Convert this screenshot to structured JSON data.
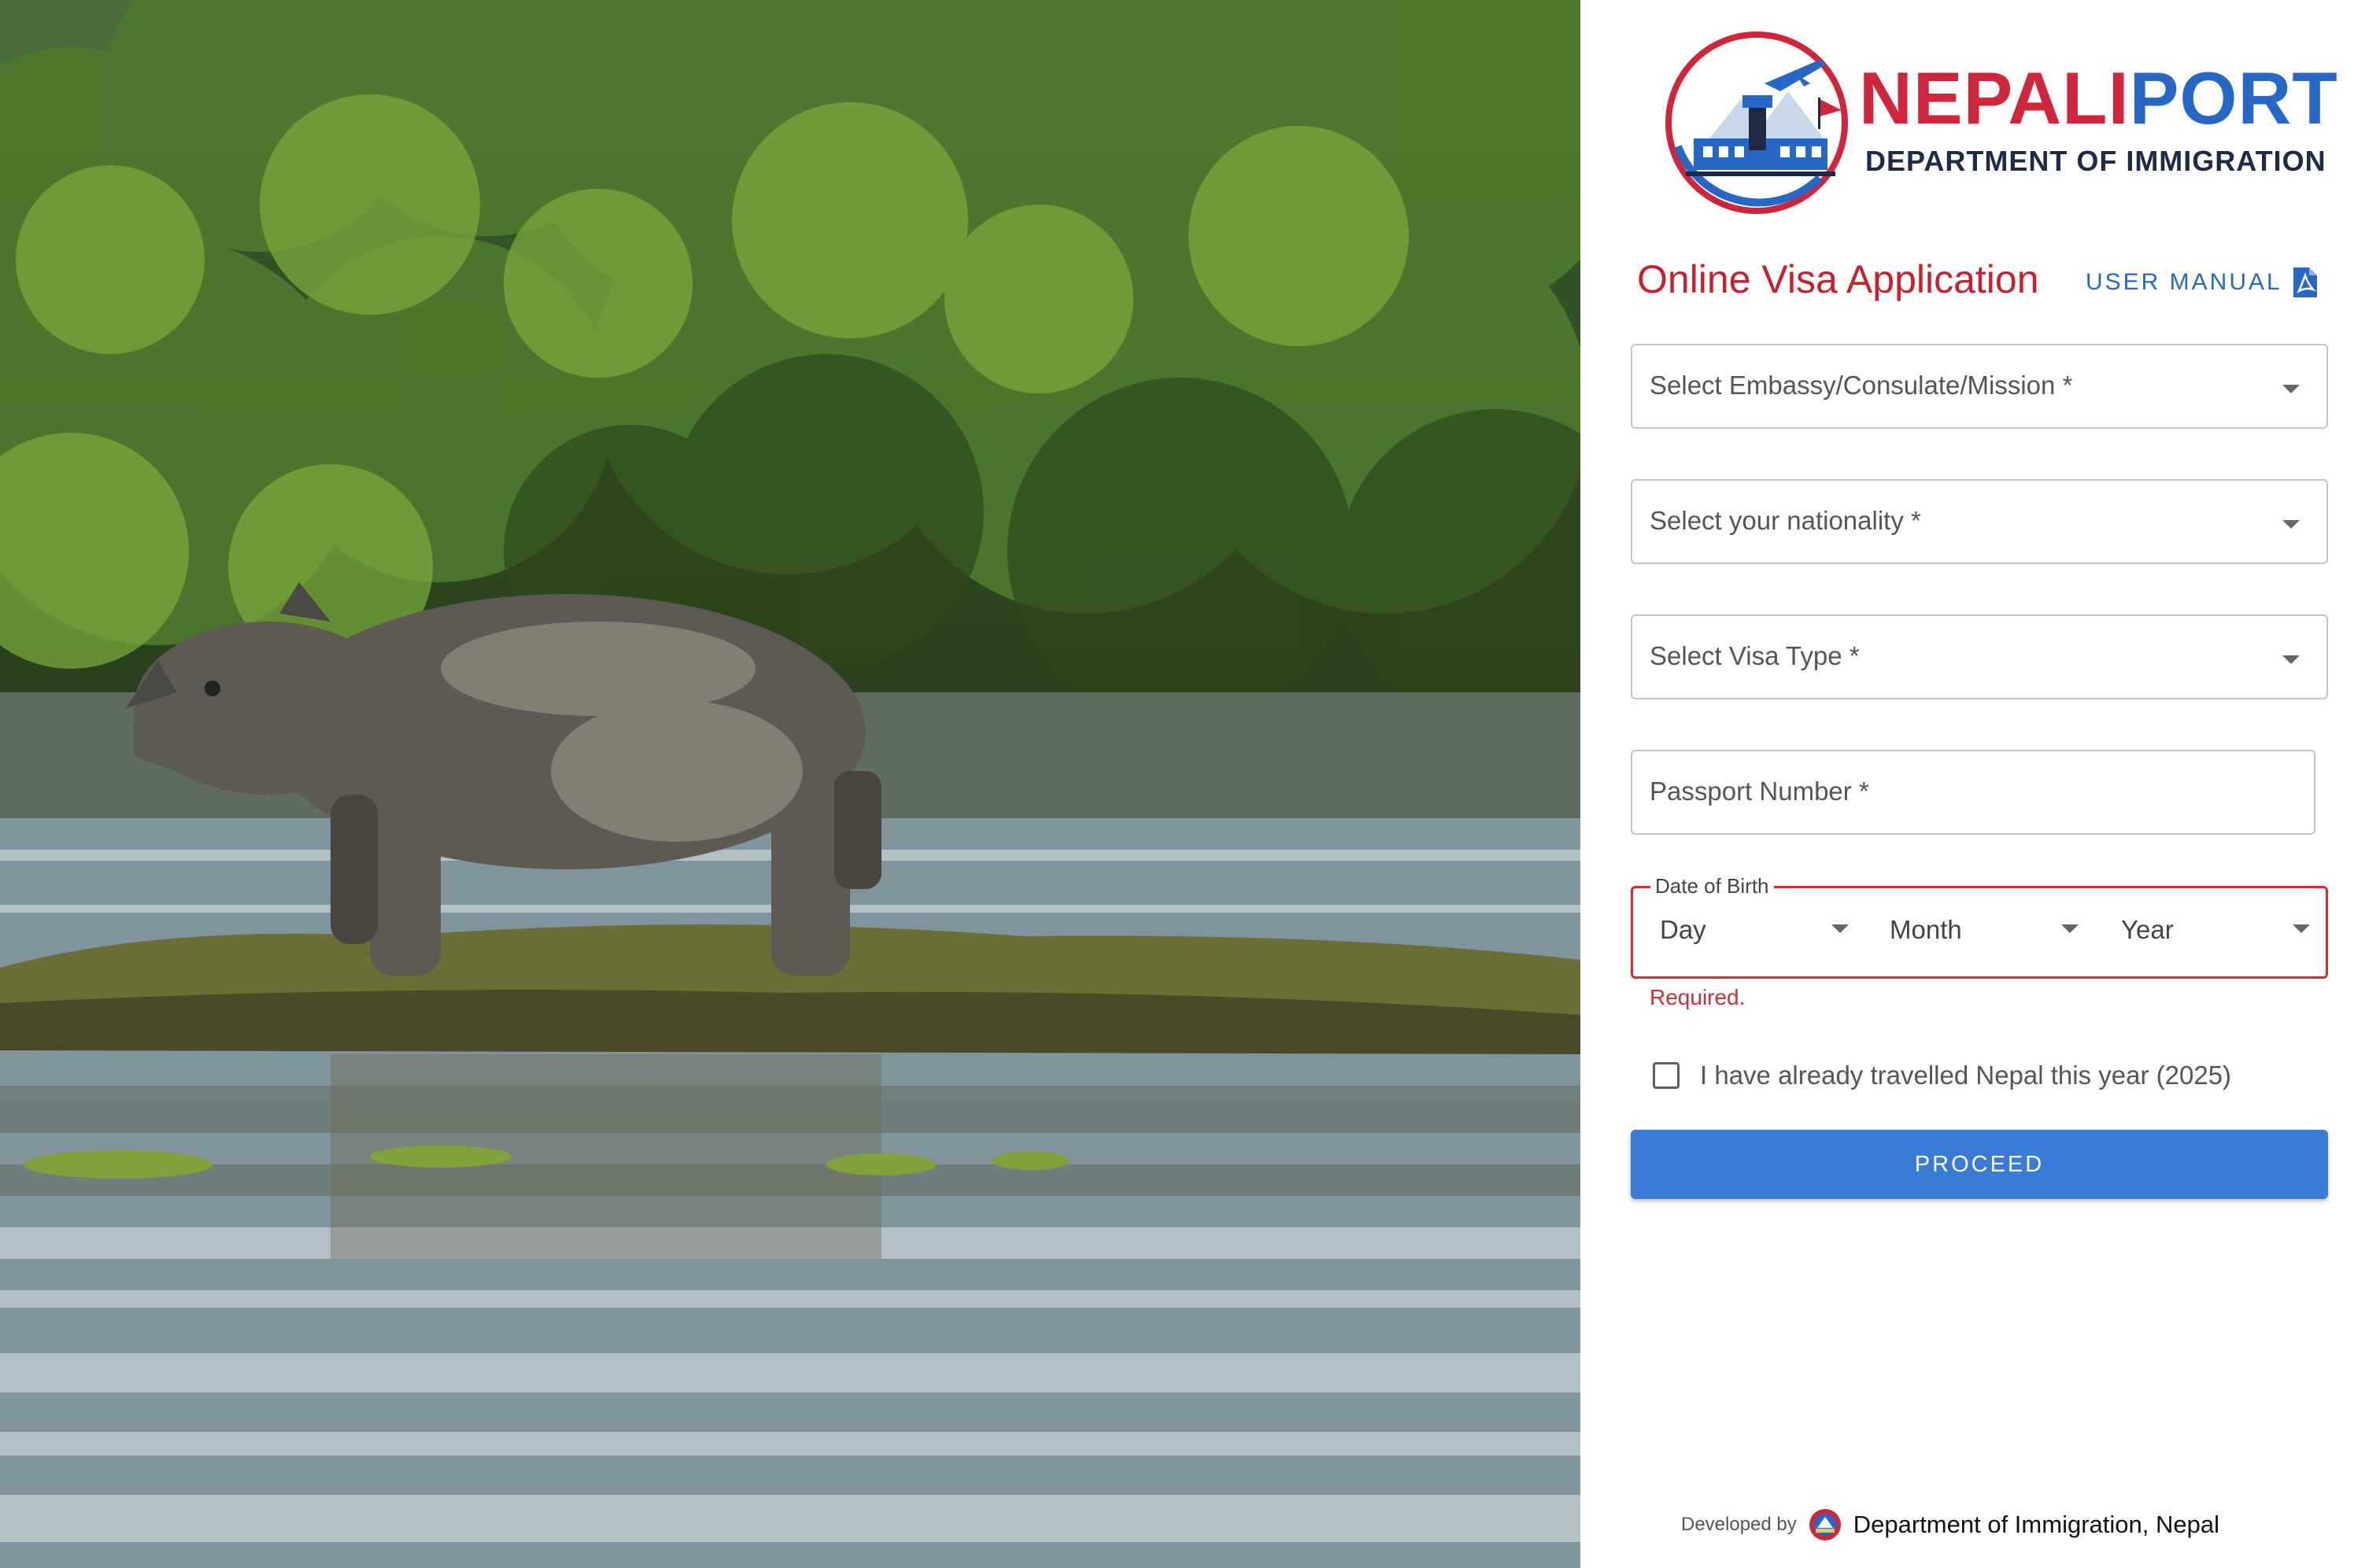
{
  "header": {
    "brand_part1": "NEPALI",
    "brand_part2": "PORT",
    "brand_subtitle": "DEPARTMENT OF IMMIGRATION",
    "logo_icon": "airport-emblem-icon"
  },
  "form": {
    "title": "Online Visa Application",
    "user_manual_label": "USER MANUAL",
    "user_manual_icon": "pdf-icon",
    "embassy_placeholder": "Select Embassy/Consulate/Mission *",
    "nationality_placeholder": "Select your nationality *",
    "visa_type_placeholder": "Select Visa Type *",
    "passport_placeholder": "Passport Number *",
    "dob": {
      "legend": "Date of Birth",
      "day": "Day",
      "month": "Month",
      "year": "Year",
      "error": "Required."
    },
    "travelled_checkbox_label": "I have already travelled Nepal this year (2025)",
    "travelled_checked": false,
    "proceed_label": "PROCEED"
  },
  "footer": {
    "developed_by": "Developed by",
    "organization": "Department of Immigration, Nepal"
  },
  "colors": {
    "brand_red": "#d0263b",
    "brand_blue": "#2767c6",
    "error_red": "#d32f2f",
    "button_blue": "#3a7bd5"
  }
}
